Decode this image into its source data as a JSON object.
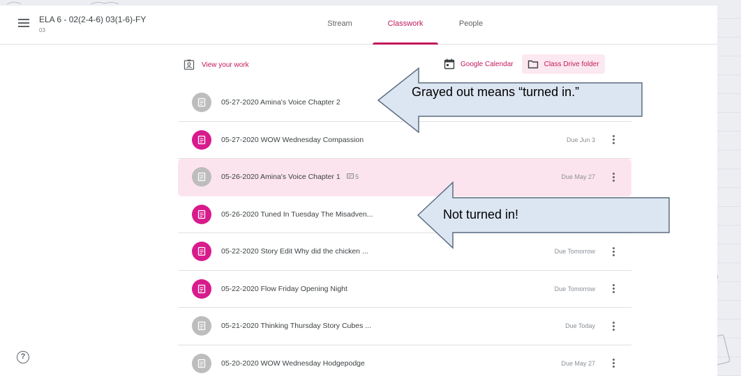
{
  "header": {
    "class_title": "ELA 6 - 02(2-4-6) 03(1-6)-FY",
    "class_section": "03",
    "tabs": [
      {
        "label": "Stream",
        "active": false
      },
      {
        "label": "Classwork",
        "active": true
      },
      {
        "label": "People",
        "active": false
      }
    ]
  },
  "toolbar": {
    "view_work": "View your work",
    "google_calendar": "Google Calendar",
    "drive_folder": "Class Drive folder"
  },
  "assignments": [
    {
      "title": "05-27-2020 Amina's Voice Chapter 2",
      "due": "",
      "status": "turned-in"
    },
    {
      "title": "05-27-2020 WOW Wednesday Compassion",
      "due": "Due Jun 3",
      "status": "assigned"
    },
    {
      "title": "05-26-2020 Amina's Voice Chapter 1",
      "comments": "5",
      "due": "Due May 27",
      "status": "turned-in"
    },
    {
      "title": "05-26-2020 Tuned In Tuesday The Misadven...",
      "due": "",
      "status": "assigned"
    },
    {
      "title": "05-22-2020 Story Edit Why did the chicken ...",
      "due": "Due Tomorrow",
      "status": "assigned"
    },
    {
      "title": "05-22-2020 Flow Friday Opening Night",
      "due": "Due Tomorrow",
      "status": "assigned"
    },
    {
      "title": "05-21-2020 Thinking Thursday Story Cubes ...",
      "due": "Due Today",
      "status": "turned-in"
    },
    {
      "title": "05-20-2020 WOW Wednesday Hodgepodge",
      "due": "Due May 27",
      "status": "turned-in"
    }
  ],
  "callouts": {
    "grayed": "Grayed out means “turned in.”",
    "not_turned": "Not turned in!"
  },
  "help": "?",
  "colors": {
    "accent": "#c2185b",
    "assigned_icon": "#d81b8c",
    "turned_in_icon": "#bdbdbd",
    "highlight_row": "#fce4ee",
    "callout_fill": "#dce6f2"
  }
}
